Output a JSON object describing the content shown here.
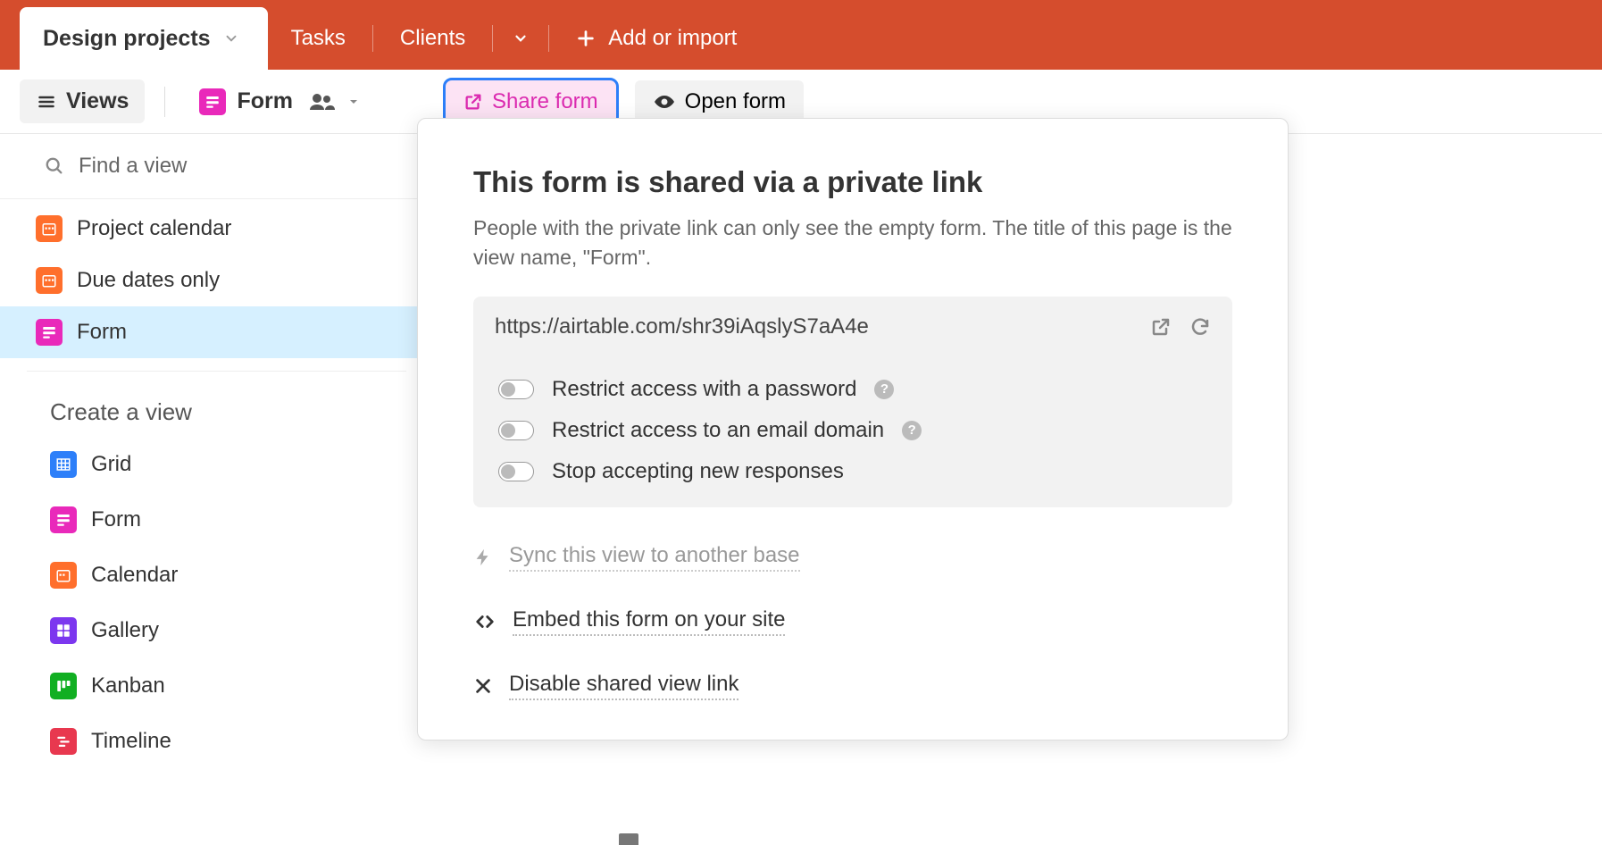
{
  "tabs": {
    "active": "Design projects",
    "items": [
      "Tasks",
      "Clients"
    ],
    "add_label": "Add or import"
  },
  "toolbar": {
    "views_label": "Views",
    "current_view": "Form",
    "share_label": "Share form",
    "open_label": "Open form"
  },
  "sidebar": {
    "search_placeholder": "Find a view",
    "views": [
      {
        "label": "Project calendar",
        "type": "calendar"
      },
      {
        "label": "Due dates only",
        "type": "calendar"
      },
      {
        "label": "Form",
        "type": "form",
        "selected": true
      }
    ],
    "create_section_title": "Create a view",
    "create_options": [
      {
        "label": "Grid",
        "type": "grid"
      },
      {
        "label": "Form",
        "type": "form"
      },
      {
        "label": "Calendar",
        "type": "calendar"
      },
      {
        "label": "Gallery",
        "type": "gallery"
      },
      {
        "label": "Kanban",
        "type": "kanban"
      },
      {
        "label": "Timeline",
        "type": "timeline"
      }
    ]
  },
  "popover": {
    "title": "This form is shared via a private link",
    "description": "People with the private link can only see the empty form. The title of this page is the view name, \"Form\".",
    "share_url": "https://airtable.com/shr39iAqslyS7aA4e",
    "options": [
      {
        "label": "Restrict access with a password",
        "help": true
      },
      {
        "label": "Restrict access to an email domain",
        "help": true
      },
      {
        "label": "Stop accepting new responses",
        "help": false
      }
    ],
    "sync_label": "Sync this view to another base",
    "embed_label": "Embed this form on your site",
    "disable_label": "Disable shared view link"
  }
}
